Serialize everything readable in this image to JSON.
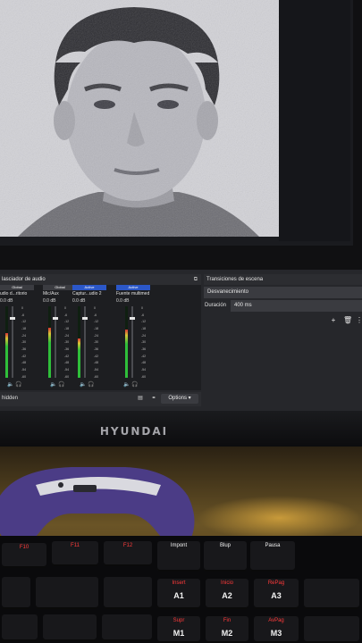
{
  "audio_mixer": {
    "title": "lasciador de audio",
    "channels": [
      {
        "badge": "Global",
        "badge_state": "global",
        "name": "udio d...ritorio",
        "db": "0.0 dB",
        "level": 0.62,
        "fader": 0.85
      },
      {
        "badge": "Global",
        "badge_state": "global",
        "name": "Mic/Aux",
        "db": "0.0 dB",
        "level": 0.7,
        "fader": 0.85
      },
      {
        "badge": "Active",
        "badge_state": "active",
        "name": "Captur...udio 2",
        "db": "0.0 dB",
        "level": 0.55,
        "fader": 0.85
      },
      {
        "badge": "Active",
        "badge_state": "active",
        "name": "Fuente multimed",
        "db": "0.0 dB",
        "level": 0.68,
        "fader": 0.85
      }
    ],
    "scale_labels": [
      "0",
      "-6",
      "-12",
      "-18",
      "-24",
      "-30",
      "-36",
      "-42",
      "-48",
      "-54",
      "-60"
    ],
    "hidden_label": "hidden",
    "options_label": "Options"
  },
  "transitions": {
    "title": "Transiciones de escena",
    "selected": "Desvanecimiento",
    "duration_label": "Duración",
    "duration_value": "400 ms"
  },
  "monitor": {
    "brand": "HYUNDAI"
  },
  "keyboard": {
    "keys": [
      {
        "top": "F10",
        "main": ""
      },
      {
        "top": "F11",
        "main": ""
      },
      {
        "top": "F12",
        "main": ""
      },
      {
        "top": "Impont",
        "main": ""
      },
      {
        "top": "Blup",
        "main": ""
      },
      {
        "top": "Pausa",
        "main": ""
      },
      {
        "top": "Insert",
        "main": "A1"
      },
      {
        "top": "Inicio",
        "main": "A2"
      },
      {
        "top": "RePag",
        "main": "A3"
      },
      {
        "top": "Supr",
        "main": "M1"
      },
      {
        "top": "Fin",
        "main": "M2"
      },
      {
        "top": "AvPag",
        "main": "M3"
      }
    ]
  },
  "colors": {
    "obs_bg": "#26272b",
    "active_badge": "#2b57c8",
    "meter_green": "#2fbf3a",
    "meter_yellow": "#d6c436",
    "meter_red": "#d93434"
  }
}
